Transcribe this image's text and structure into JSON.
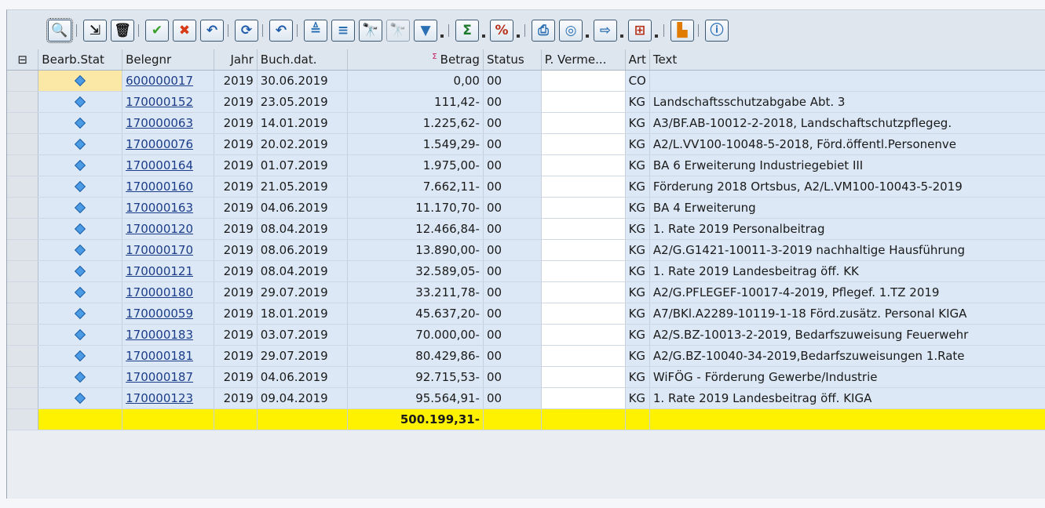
{
  "toolbar": {
    "icons": [
      "details-icon",
      "choose-layout-icon",
      "delete-icon",
      "check-icon",
      "cancel-icon",
      "undo-icon",
      "refresh-icon",
      "undo2-icon",
      "sort-asc-icon",
      "sort-desc-icon",
      "find-icon",
      "find-next-icon",
      "filter-icon",
      "sum-icon",
      "subtotal-icon",
      "print-icon",
      "view-icon",
      "export-icon",
      "layout-icon",
      "graphic-icon",
      "info-icon"
    ]
  },
  "columns": {
    "select": "",
    "bearb_stat": "Bearb.Stat",
    "belegnr": "Belegnr",
    "jahr": "Jahr",
    "buch_dat": "Buch.dat.",
    "betrag": "Betrag",
    "status": "Status",
    "p_verme": "P. Verme...",
    "art": "Art",
    "text": "Text"
  },
  "rows": [
    {
      "belegnr": "600000017",
      "jahr": "2019",
      "buch_dat": "30.06.2019",
      "betrag": "0,00",
      "status": "00",
      "p_verme": "",
      "art": "CO",
      "text": ""
    },
    {
      "belegnr": "170000152",
      "jahr": "2019",
      "buch_dat": "23.05.2019",
      "betrag": "111,42-",
      "status": "00",
      "p_verme": "",
      "art": "KG",
      "text": "Landschaftsschutzabgabe Abt. 3"
    },
    {
      "belegnr": "170000063",
      "jahr": "2019",
      "buch_dat": "14.01.2019",
      "betrag": "1.225,62-",
      "status": "00",
      "p_verme": "",
      "art": "KG",
      "text": "A3/BF.AB-10012-2-2018, Landschaftschutzpflegeg."
    },
    {
      "belegnr": "170000076",
      "jahr": "2019",
      "buch_dat": "20.02.2019",
      "betrag": "1.549,29-",
      "status": "00",
      "p_verme": "",
      "art": "KG",
      "text": "A2/L.VV100-10048-5-2018, Förd.öffentl.Personenve"
    },
    {
      "belegnr": "170000164",
      "jahr": "2019",
      "buch_dat": "01.07.2019",
      "betrag": "1.975,00-",
      "status": "00",
      "p_verme": "",
      "art": "KG",
      "text": "BA 6 Erweiterung Industriegebiet III"
    },
    {
      "belegnr": "170000160",
      "jahr": "2019",
      "buch_dat": "21.05.2019",
      "betrag": "7.662,11-",
      "status": "00",
      "p_verme": "",
      "art": "KG",
      "text": "Förderung 2018 Ortsbus, A2/L.VM100-10043-5-2019"
    },
    {
      "belegnr": "170000163",
      "jahr": "2019",
      "buch_dat": "04.06.2019",
      "betrag": "11.170,70-",
      "status": "00",
      "p_verme": "",
      "art": "KG",
      "text": "BA 4 Erweiterung"
    },
    {
      "belegnr": "170000120",
      "jahr": "2019",
      "buch_dat": "08.04.2019",
      "betrag": "12.466,84-",
      "status": "00",
      "p_verme": "",
      "art": "KG",
      "text": "1. Rate 2019 Personalbeitrag"
    },
    {
      "belegnr": "170000170",
      "jahr": "2019",
      "buch_dat": "08.06.2019",
      "betrag": "13.890,00-",
      "status": "00",
      "p_verme": "",
      "art": "KG",
      "text": "A2/G.G1421-10011-3-2019 nachhaltige Hausführung"
    },
    {
      "belegnr": "170000121",
      "jahr": "2019",
      "buch_dat": "08.04.2019",
      "betrag": "32.589,05-",
      "status": "00",
      "p_verme": "",
      "art": "KG",
      "text": "1. Rate 2019 Landesbeitrag öff. KK"
    },
    {
      "belegnr": "170000180",
      "jahr": "2019",
      "buch_dat": "29.07.2019",
      "betrag": "33.211,78-",
      "status": "00",
      "p_verme": "",
      "art": "KG",
      "text": "A2/G.PFLEGEF-10017-4-2019, Pflegef. 1.TZ 2019"
    },
    {
      "belegnr": "170000059",
      "jahr": "2019",
      "buch_dat": "18.01.2019",
      "betrag": "45.637,20-",
      "status": "00",
      "p_verme": "",
      "art": "KG",
      "text": "A7/BKl.A2289-10119-1-18 Förd.zusätz. Personal KIGA"
    },
    {
      "belegnr": "170000183",
      "jahr": "2019",
      "buch_dat": "03.07.2019",
      "betrag": "70.000,00-",
      "status": "00",
      "p_verme": "",
      "art": "KG",
      "text": "A2/S.BZ-10013-2-2019, Bedarfszuweisung Feuerwehr"
    },
    {
      "belegnr": "170000181",
      "jahr": "2019",
      "buch_dat": "29.07.2019",
      "betrag": "80.429,86-",
      "status": "00",
      "p_verme": "",
      "art": "KG",
      "text": "A2/G.BZ-10040-34-2019,Bedarfszuweisungen 1.Rate"
    },
    {
      "belegnr": "170000187",
      "jahr": "2019",
      "buch_dat": "04.06.2019",
      "betrag": "92.715,53-",
      "status": "00",
      "p_verme": "",
      "art": "KG",
      "text": "WiFÖG - Förderung Gewerbe/Industrie"
    },
    {
      "belegnr": "170000123",
      "jahr": "2019",
      "buch_dat": "09.04.2019",
      "betrag": "95.564,91-",
      "status": "00",
      "p_verme": "",
      "art": "KG",
      "text": "1. Rate 2019 Landesbeitrag öff. KIGA"
    }
  ],
  "total": {
    "betrag": "500.199,31-"
  },
  "colors": {
    "total_row": "#fff200",
    "selected_cell": "#fce8a6",
    "row_bg": "#dce8f5",
    "diamond": "#4b9ae4"
  }
}
